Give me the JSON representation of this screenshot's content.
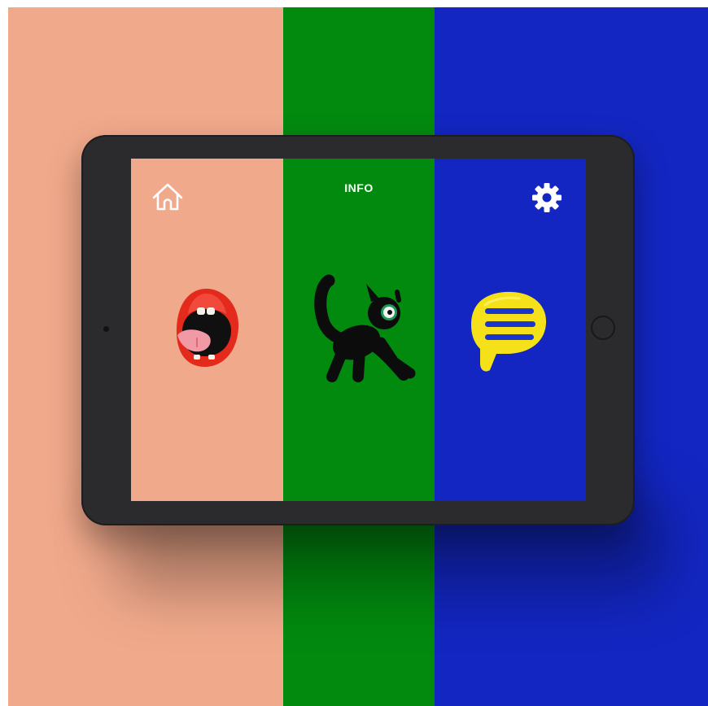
{
  "colors": {
    "peach": "#f1a98b",
    "green": "#028a0f",
    "blue": "#1326c1",
    "device": "#2b2b2e"
  },
  "header": {
    "home_icon": "home-icon",
    "title": "INFO",
    "settings_icon": "gear-icon"
  },
  "panels": [
    {
      "icon": "mouth-icon"
    },
    {
      "icon": "cat-icon"
    },
    {
      "icon": "speech-bubble-icon"
    }
  ]
}
